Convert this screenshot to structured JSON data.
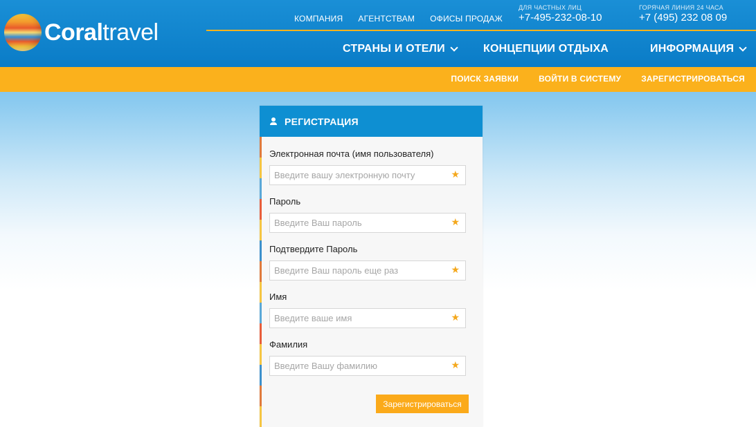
{
  "brand": {
    "bold": "Coral",
    "light": "travel"
  },
  "topnav": [
    "КОМПАНИЯ",
    "АГЕНТСТВАМ",
    "ОФИСЫ ПРОДАЖ"
  ],
  "phones": [
    {
      "label": "ДЛЯ ЧАСТНЫХ ЛИЦ",
      "number": "+7-495-232-08-10"
    },
    {
      "label": "ГОРЯЧАЯ ЛИНИЯ 24 ЧАСА",
      "number": "+7 (495) 232 08 09"
    }
  ],
  "mainnav": [
    {
      "label": "СТРАНЫ И ОТЕЛИ",
      "dropdown": true
    },
    {
      "label": "КОНЦЕПЦИИ ОТДЫХА",
      "dropdown": false
    },
    {
      "label": "ИНФОРМАЦИЯ",
      "dropdown": true
    }
  ],
  "subnav": [
    "ПОИСК ЗАЯВКИ",
    "ВОЙТИ В СИСТЕМУ",
    "ЗАРЕГИСТРИРОВАТЬСЯ"
  ],
  "form": {
    "title": "РЕГИСТРАЦИЯ",
    "fields": [
      {
        "label": "Электронная почта (имя пользователя)",
        "placeholder": "Введите вашу электронную почту",
        "required_mark": "★"
      },
      {
        "label": "Пароль",
        "placeholder": "Введите Ваш пароль",
        "required_mark": "★"
      },
      {
        "label": "Подтвердите Пароль",
        "placeholder": "Введите Ваш пароль еще раз",
        "required_mark": "★"
      },
      {
        "label": "Имя",
        "placeholder": "Введите ваше имя",
        "required_mark": "★"
      },
      {
        "label": "Фамилия",
        "placeholder": "Введите Вашу фамилию",
        "required_mark": "★"
      }
    ],
    "submit_label": "Зарегистрироваться"
  },
  "colors": {
    "header_blue": "#0a7cc7",
    "accent_orange": "#fbb11c",
    "panel_head_blue": "#0e8fd2"
  }
}
